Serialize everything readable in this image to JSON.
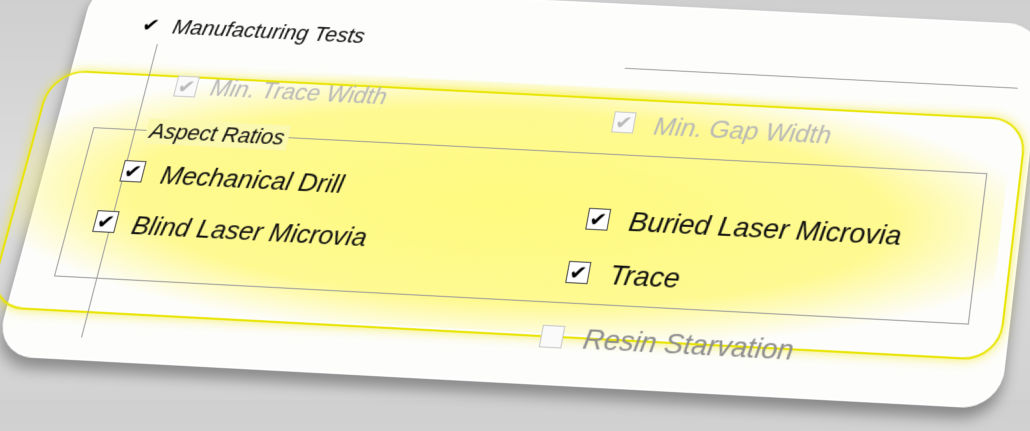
{
  "manufacturing_tests": {
    "label": "Manufacturing Tests",
    "checked": true
  },
  "min_trace_width": {
    "label": "Min. Trace Width",
    "checked": true,
    "enabled": false
  },
  "min_gap_width": {
    "label": "Min. Gap Width",
    "checked": true,
    "enabled": false
  },
  "aspect_ratios": {
    "title": "Aspect Ratios",
    "items": [
      {
        "label": "Mechanical Drill",
        "checked": true
      },
      {
        "label": "Blind Laser Microvia",
        "checked": true
      },
      {
        "label": "Buried Laser Microvia",
        "checked": true
      },
      {
        "label": "Trace",
        "checked": true
      }
    ]
  },
  "resin_starvation": {
    "label": "Resin Starvation",
    "checked": false,
    "enabled": false
  },
  "check_glyph": "✔"
}
